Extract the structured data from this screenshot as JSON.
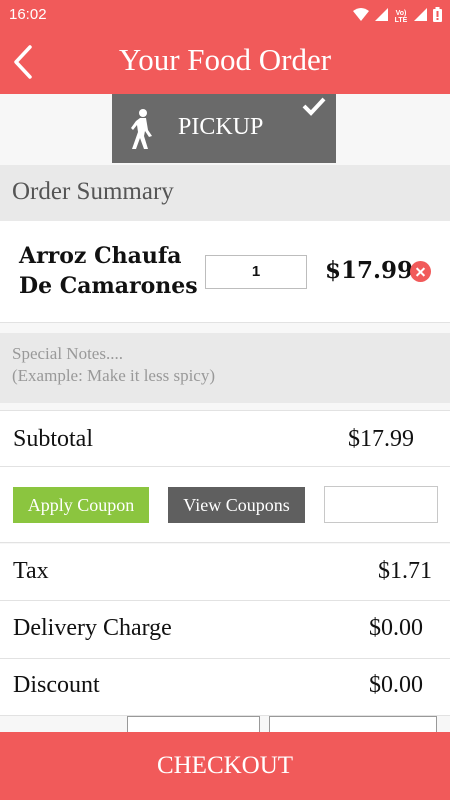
{
  "status_bar": {
    "time": "16:02",
    "icons": [
      "wifi-icon",
      "signal-icon",
      "volte-icon",
      "signal-icon",
      "battery-icon"
    ],
    "volte_text": "Vo) LTE"
  },
  "header": {
    "title": "Your Food Order",
    "back_icon": "chevron-left-icon",
    "color": "#f15a5a"
  },
  "order_type": {
    "label": "PICKUP",
    "icon": "walking-person-icon",
    "selected": true
  },
  "summary": {
    "heading": "Order Summary"
  },
  "items": [
    {
      "name": "Arroz Chaufa De Camarones",
      "quantity": "1",
      "price": "$17.99"
    }
  ],
  "notes": {
    "placeholder": "Special Notes....\n(Example: Make it less spicy)"
  },
  "totals": {
    "subtotal_label": "Subtotal",
    "subtotal_value": "$17.99",
    "tax_label": "Tax",
    "tax_value": "$1.71",
    "delivery_label": "Delivery Charge",
    "delivery_value": "$0.00",
    "discount_label": "Discount",
    "discount_value": "$0.00"
  },
  "coupons": {
    "apply_label": "Apply Coupon",
    "view_label": "View Coupons",
    "code_value": "",
    "apply_color": "#8bc53f"
  },
  "checkout": {
    "label": "CHECKOUT"
  }
}
